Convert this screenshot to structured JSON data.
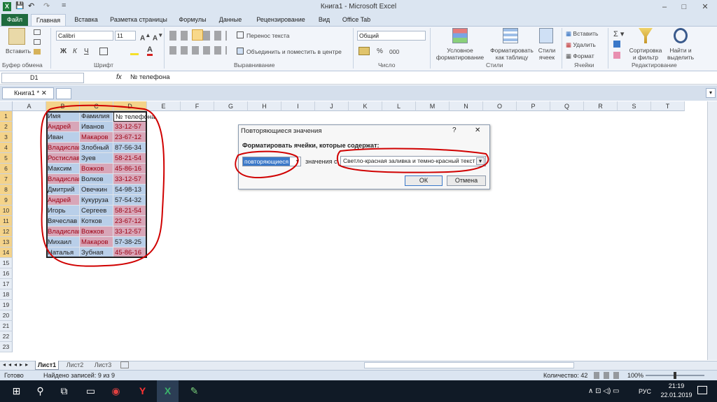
{
  "window": {
    "title": "Книга1 - Microsoft Excel",
    "controls": [
      "–",
      "□",
      "✕"
    ]
  },
  "qat": [
    "X",
    "💾",
    "↶",
    "↷",
    "="
  ],
  "ribbon_tabs": [
    "Файл",
    "Главная",
    "Вставка",
    "Разметка страницы",
    "Формулы",
    "Данные",
    "Рецензирование",
    "Вид",
    "Office Tab"
  ],
  "ribbon": {
    "paste": "Вставить",
    "clipboard": "Буфер обмена",
    "font_name": "Calibri",
    "font_size": "11",
    "font_group": "Шрифт",
    "bold": "Ж",
    "italic": "К",
    "underline": "Ч",
    "wrap_text": "Перенос текста",
    "merge_center": "Объединить и поместить в центре",
    "alignment_group": "Выравнивание",
    "number_format": "Общий",
    "number_group": "Число",
    "cond_format": "Условное форматирование",
    "format_table": "Форматировать как таблицу",
    "cell_styles": "Стили ячеек",
    "styles_group": "Стили",
    "insert": "Вставить",
    "delete": "Удалить",
    "format": "Формат",
    "cells_group": "Ячейки",
    "sort_filter": "Сортировка и фильтр",
    "find_select": "Найти и выделить",
    "editing_group": "Редактирование",
    "percent": "%",
    "thousands": "000"
  },
  "formula_bar": {
    "name_box": "D1",
    "fx": "fx",
    "formula": "№ телефона"
  },
  "workbook_tab": "Книга1 *",
  "columns": [
    "A",
    "B",
    "C",
    "D",
    "E",
    "F",
    "G",
    "H",
    "I",
    "J",
    "K",
    "L",
    "M",
    "N",
    "O",
    "P",
    "Q",
    "R",
    "S",
    "T"
  ],
  "rows": [
    "1",
    "2",
    "3",
    "4",
    "5",
    "6",
    "7",
    "8",
    "9",
    "10",
    "11",
    "12",
    "13",
    "14",
    "15",
    "16",
    "17",
    "18",
    "19",
    "20",
    "21",
    "22",
    "23"
  ],
  "table": {
    "header": [
      "Имя",
      "Фамилия",
      "№ телефона"
    ],
    "rows": [
      [
        "Андрей",
        "Иванов",
        "33-12-57"
      ],
      [
        "Иван",
        "Макаров",
        "23-67-12"
      ],
      [
        "Владислав",
        "Злобный",
        "87-56-34"
      ],
      [
        "Ростислав",
        "Зуев",
        "58-21-54"
      ],
      [
        "Максим",
        "Вожков",
        "45-86-16"
      ],
      [
        "Владислав",
        "Волков",
        "33-12-57"
      ],
      [
        "Дмитрий",
        "Овечкин",
        "54-98-13"
      ],
      [
        "Андрей",
        "Кукуруза",
        "57-54-32"
      ],
      [
        "Игорь",
        "Сергеев",
        "58-21-54"
      ],
      [
        "Вячеслав",
        "Котков",
        "23-67-12"
      ],
      [
        "Владислав",
        "Вожков",
        "33-12-57"
      ],
      [
        "Михаил",
        "Макаров",
        "57-38-25"
      ],
      [
        "Наталья",
        "Зубная",
        "45-86-16"
      ]
    ],
    "dup": [
      [
        true,
        false,
        true
      ],
      [
        false,
        true,
        true
      ],
      [
        true,
        false,
        false
      ],
      [
        true,
        false,
        true
      ],
      [
        false,
        true,
        true
      ],
      [
        true,
        false,
        true
      ],
      [
        false,
        false,
        false
      ],
      [
        true,
        false,
        false
      ],
      [
        false,
        false,
        true
      ],
      [
        false,
        false,
        true
      ],
      [
        true,
        true,
        true
      ],
      [
        false,
        true,
        false
      ],
      [
        false,
        false,
        true
      ]
    ]
  },
  "dialog": {
    "title": "Повторяющиеся значения",
    "help": "?",
    "close": "✕",
    "prompt": "Форматировать ячейки, которые содержат:",
    "type_value": "повторяющиеся",
    "middle": "значения с",
    "format_value": "Светло-красная заливка и темно-красный текст",
    "ok": "ОК",
    "cancel": "Отмена"
  },
  "sheets": [
    "Лист1",
    "Лист2",
    "Лист3"
  ],
  "status": {
    "ready": "Готово",
    "found": "Найдено записей: 9 из 9",
    "count": "Количество: 42",
    "zoom": "100%"
  },
  "taskbar": {
    "lang": "РУС",
    "time": "21:19",
    "date": "22.01.2019"
  },
  "colors": {
    "dup_fill": "#d8a6b8",
    "dup_text": "#9c0012",
    "selection": "#b9cfe9",
    "annotation": "#d00000"
  }
}
